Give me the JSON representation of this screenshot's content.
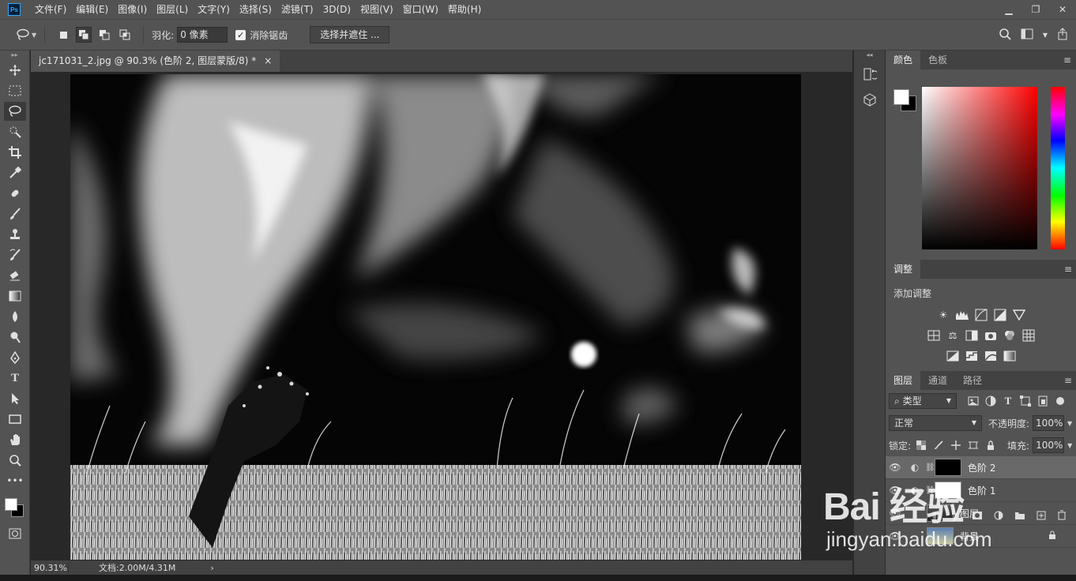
{
  "app": {
    "logo": "Ps"
  },
  "menu": [
    "文件(F)",
    "编辑(E)",
    "图像(I)",
    "图层(L)",
    "文字(Y)",
    "选择(S)",
    "滤镜(T)",
    "3D(D)",
    "视图(V)",
    "窗口(W)",
    "帮助(H)"
  ],
  "options": {
    "feather_label": "羽化:",
    "feather_value": "0 像素",
    "antialias_label": "消除锯齿",
    "select_mask_button": "选择并遮住 ..."
  },
  "document": {
    "tab_title": "jc171031_2.jpg @ 90.3% (色阶 2, 图层蒙版/8) *",
    "close": "×",
    "zoom": "90.31%",
    "doc_info": "文档:2.00M/4.31M"
  },
  "color_panel": {
    "tabs": [
      "颜色",
      "色板"
    ]
  },
  "adjust_panel": {
    "tab": "调整",
    "title": "添加调整"
  },
  "layers_panel": {
    "tabs": [
      "图层",
      "通道",
      "路径"
    ],
    "kind_filter": "类型",
    "blend_mode": "正常",
    "opacity_label": "不透明度:",
    "opacity_value": "100%",
    "lock_label": "锁定:",
    "fill_label": "填充:",
    "fill_value": "100%",
    "layers": [
      {
        "name": "色阶 2",
        "selected": true
      },
      {
        "name": "色阶 1",
        "selected": false
      },
      {
        "name": "图层",
        "selected": false
      },
      {
        "name": "背景",
        "selected": false
      }
    ]
  },
  "watermark": {
    "logo": "Bai 经验",
    "url": "jingyan.baidu.com"
  }
}
